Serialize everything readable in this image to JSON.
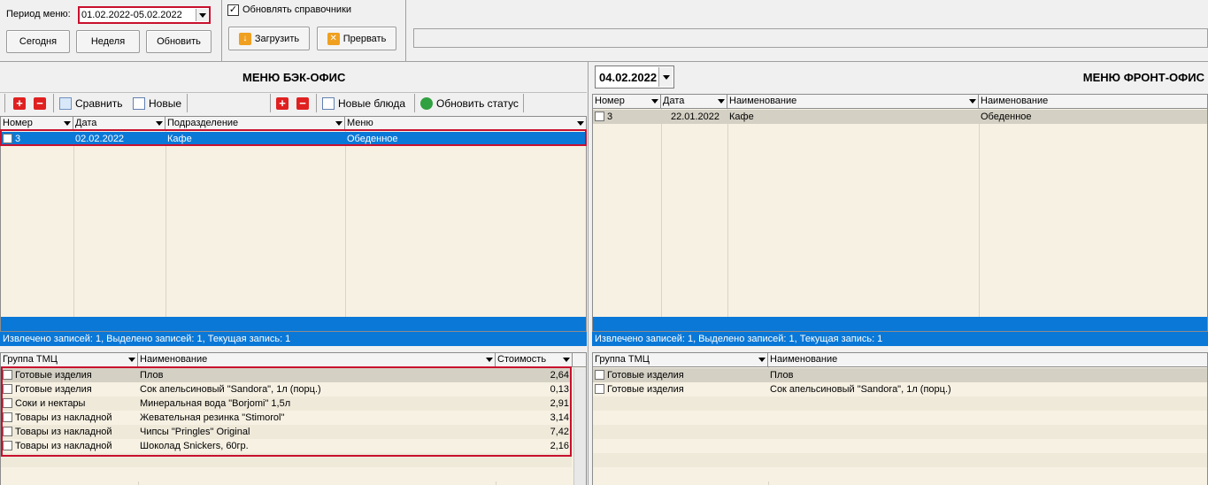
{
  "toolbar": {
    "period_label": "Период меню:",
    "period_value": "01.02.2022-05.02.2022",
    "today_label": "Сегодня",
    "week_label": "Неделя",
    "refresh_label": "Обновить",
    "update_refs_label": "Обновлять справочники",
    "update_refs_checked": true,
    "load_label": "Загрузить",
    "abort_label": "Прервать"
  },
  "back_office": {
    "title": "МЕНЮ БЭК-ОФИС",
    "compare_label": "Сравнить",
    "new_label": "Новые",
    "new_dishes_label": "Новые блюда",
    "update_status_label": "Обновить статус",
    "columns": [
      "Номер",
      "Дата",
      "Подразделение",
      "Меню"
    ],
    "rows": [
      {
        "num": "3",
        "date": "02.02.2022",
        "dept": "Кафе",
        "menu": "Обеденное"
      }
    ],
    "status": "Извлечено записей: 1, Выделено записей: 1, Текущая запись: 1",
    "items_columns": [
      "Группа ТМЦ",
      "Наименование",
      "Стоимость"
    ],
    "items": [
      {
        "group": "Готовые изделия",
        "name": "Плов",
        "cost": "2,64"
      },
      {
        "group": "Готовые изделия",
        "name": "Сок апельсиновый \"Sandora\", 1л (порц.)",
        "cost": "0,13"
      },
      {
        "group": "Соки и нектары",
        "name": "Минеральная вода \"Borjomi\" 1,5л",
        "cost": "2,91"
      },
      {
        "group": "Товары из накладной",
        "name": "Жевательная резинка \"Stimorol\"",
        "cost": "3,14"
      },
      {
        "group": "Товары из накладной",
        "name": "Чипсы \"Pringles\" Original",
        "cost": "7,42"
      },
      {
        "group": "Товары из накладной",
        "name": "Шоколад Snickers, 60гр.",
        "cost": "2,16"
      }
    ]
  },
  "front_office": {
    "date_value": "04.02.2022",
    "title": "МЕНЮ ФРОНТ-ОФИС",
    "columns": [
      "Номер",
      "Дата",
      "Наименование",
      "Наименование"
    ],
    "rows": [
      {
        "num": "3",
        "date": "22.01.2022",
        "name": "Кафе",
        "menu": "Обеденное"
      }
    ],
    "status": "Извлечено записей: 1, Выделено записей: 1, Текущая запись: 1",
    "items_columns": [
      "Группа ТМЦ",
      "Наименование"
    ],
    "items": [
      {
        "group": "Готовые изделия",
        "name": "Плов"
      },
      {
        "group": "Готовые изделия",
        "name": "Сок апельсиновый \"Sandora\", 1л (порц.)"
      }
    ]
  },
  "colors": {
    "selection": "#0a78d7",
    "highlight_border": "#c8102e",
    "grid_bg": "#f7f1e3"
  }
}
